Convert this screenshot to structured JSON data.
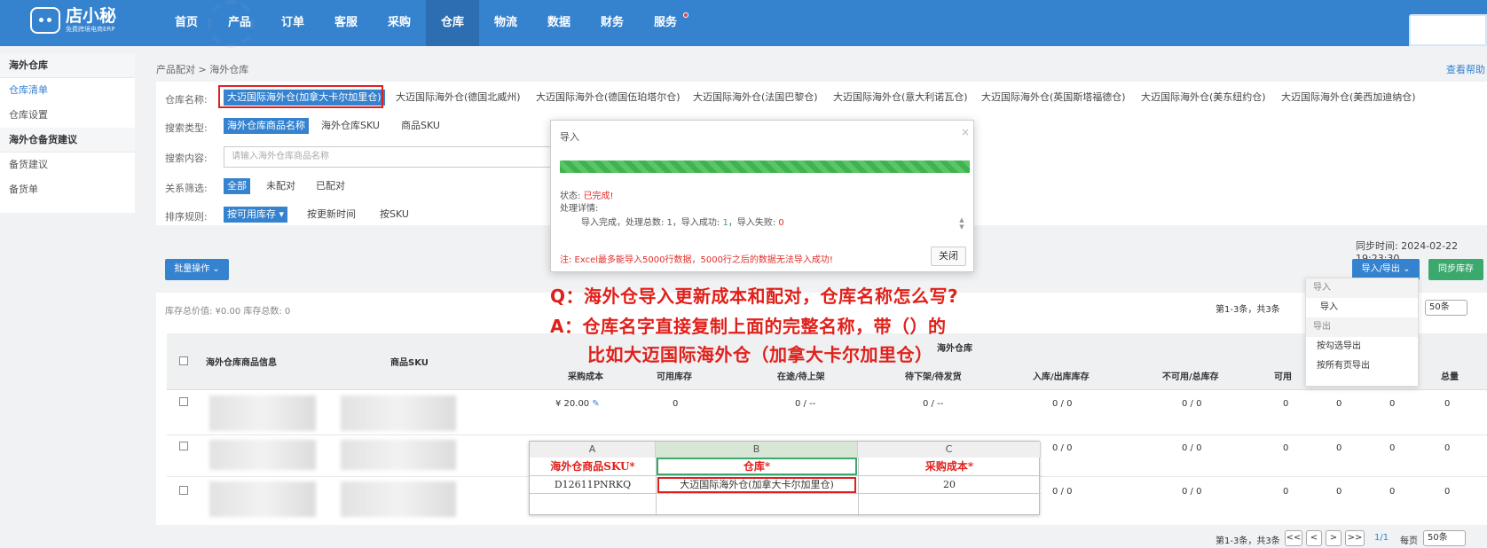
{
  "nav": {
    "logo_title": "店小秘",
    "logo_sub": "免费跨境电商ERP",
    "items": [
      "首页",
      "产品",
      "订单",
      "客服",
      "采购",
      "仓库",
      "物流",
      "数据",
      "财务",
      "服务"
    ]
  },
  "sidebar": {
    "group1": "海外仓库",
    "item1": "仓库清单",
    "item2": "仓库设置",
    "group2": "海外仓备货建议",
    "item3": "备货建议",
    "item4": "备货单"
  },
  "breadcrumb": {
    "parent": "产品配对",
    "sep": ">",
    "current": "海外仓库"
  },
  "help_link": "查看帮助",
  "filters": {
    "warehouse_label": "仓库名称:",
    "warehouses": [
      "大迈国际海外仓(加拿大卡尔加里仓)",
      "大迈国际海外仓(德国北威州)",
      "大迈国际海外仓(德国伍珀塔尔仓)",
      "大迈国际海外仓(法国巴黎仓)",
      "大迈国际海外仓(意大利诺瓦仓)",
      "大迈国际海外仓(英国斯塔福德仓)",
      "大迈国际海外仓(美东纽约仓)",
      "大迈国际海外仓(美西加迪纳仓)"
    ],
    "search_type_label": "搜索类型:",
    "search_types": [
      "海外仓库商品名称",
      "海外仓库SKU",
      "商品SKU"
    ],
    "search_content_label": "搜索内容:",
    "search_placeholder": "请输入海外仓库商品名称",
    "relation_label": "关系筛选:",
    "relations": [
      "全部",
      "未配对",
      "已配对"
    ],
    "sort_label": "排序规则:",
    "sorts": [
      "按可用库存 ▾",
      "按更新时间",
      "按SKU"
    ]
  },
  "sync_time": "同步时间: 2024-02-22 19:23:30",
  "buttons": {
    "batch": "批量操作 ⌄",
    "import_export": "导入/导出 ⌄",
    "sync_stock": "同步库存"
  },
  "summary": "库存总价值: ¥0.00 库存总数: 0",
  "pager": {
    "info": "第1-3条，共3条",
    "page": "1/1",
    "per_page_label": "每页",
    "per_page": "50条",
    "first": "<<",
    "prev": "<",
    "next": ">",
    "last": ">>"
  },
  "table": {
    "headers": {
      "product_info": "海外仓库商品信息",
      "sku": "商品SKU",
      "group": "海外仓库",
      "purchase_cost": "采购成本",
      "available": "可用库存",
      "in_transit": "在途/待上架",
      "pending": "待下架/待发货",
      "in_out": "入库/出库库存",
      "unavailable": "不可用/总库存",
      "usable": "可用",
      "total": "总量"
    },
    "row1": {
      "cost": "¥ 20.00",
      "available": "0",
      "in_transit": "0 / --",
      "pending": "0 / --",
      "in_out": "0 / 0",
      "unavailable": "0 / 0",
      "c1": "0",
      "c2": "0",
      "c3": "0",
      "c4": "0"
    },
    "row2": {
      "in_out": "0 / 0",
      "unavailable": "0 / 0",
      "c1": "0",
      "c2": "0",
      "c3": "0",
      "c4": "0"
    },
    "row3": {
      "in_out": "0 / 0",
      "unavailable": "0 / 0",
      "c1": "0",
      "c2": "0",
      "c3": "0",
      "c4": "0"
    }
  },
  "modal": {
    "title": "导入",
    "close_x": "×",
    "status_label": "状态:",
    "status_value": "已完成!",
    "detail_label": "处理详情:",
    "detail_prefix": "导入完成，处理总数: 1，导入成功:",
    "success": "1",
    "fail_label": "，导入失败:",
    "fail": "0",
    "note": "注: Excel最多能导入5000行数据，5000行之后的数据无法导入成功!",
    "close_button": "关闭",
    "progress": 1.0
  },
  "dropdown": {
    "import_head": "导入",
    "import_item": "导入",
    "export_head": "导出",
    "export_selected": "按勾选导出",
    "export_all": "按所有页导出"
  },
  "annotation": {
    "q": "Q：海外仓导入更新成本和配对，仓库名称怎么写?",
    "a1": "A：仓库名字直接复制上面的完整名称，带（）的",
    "a2": "比如大迈国际海外仓（加拿大卡尔加里仓）"
  },
  "excel": {
    "cols": [
      "A",
      "B",
      "C"
    ],
    "headers": [
      "海外仓商品SKU*",
      "仓库*",
      "采购成本*"
    ],
    "row": [
      "D12611PNRKQ",
      "大迈国际海外仓(加拿大卡尔加里仓)",
      "20"
    ]
  }
}
